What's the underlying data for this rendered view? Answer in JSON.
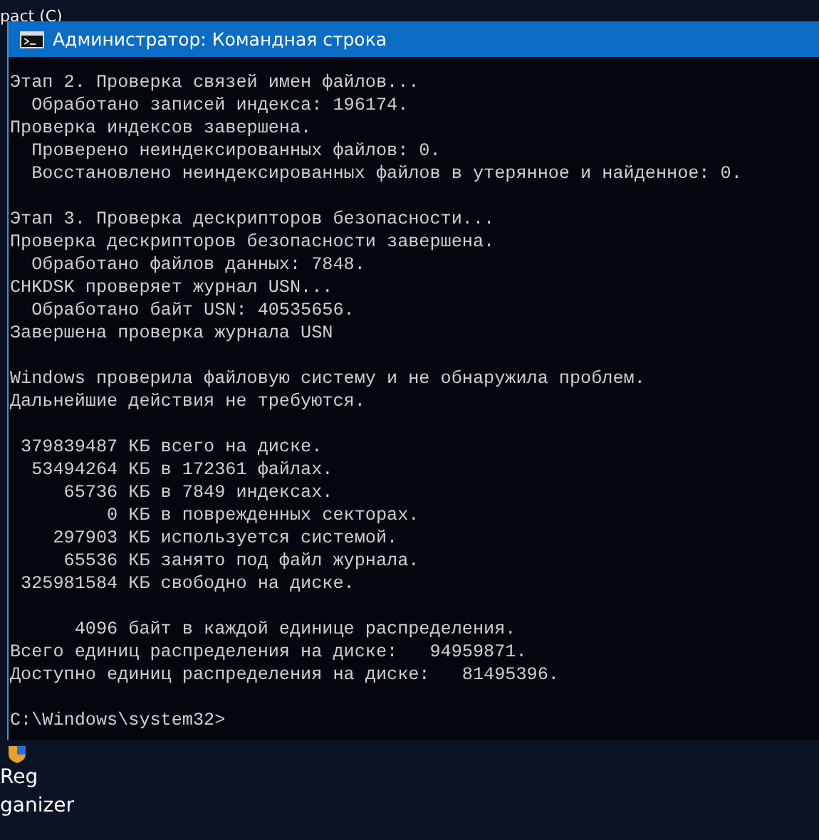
{
  "desktop_top": {
    "label": "pact (C)"
  },
  "window": {
    "title": "Администратор: Командная строка",
    "blocks": [
      [
        "Этап 2. Проверка связей имен файлов...",
        "  Обработано записей индекса: 196174.",
        "Проверка индексов завершена.",
        "  Проверено неиндексированных файлов: 0.",
        "  Восстановлено неиндексированных файлов в утерянное и найденное: 0."
      ],
      [
        "Этап 3. Проверка дескрипторов безопасности...",
        "Проверка дескрипторов безопасности завершена.",
        "  Обработано файлов данных: 7848.",
        "CHKDSK проверяет журнал USN...",
        "  Обработано байт USN: 40535656.",
        "Завершена проверка журнала USN"
      ],
      [
        "Windows проверила файловую систему и не обнаружила проблем.",
        "Дальнейшие действия не требуются."
      ],
      [
        " 379839487 КБ всего на диске.",
        "  53494264 КБ в 172361 файлах.",
        "     65736 КБ в 7849 индексах.",
        "         0 КБ в поврежденных секторах.",
        "    297903 КБ используется системой.",
        "     65536 КБ занято под файл журнала.",
        " 325981584 КБ свободно на диске."
      ],
      [
        "      4096 байт в каждой единице распределения.",
        "Всего единиц распределения на диске:   94959871.",
        "Доступно единиц распределения на диске:   81495396."
      ],
      [
        "C:\\Windows\\system32>"
      ]
    ]
  },
  "desktop_bottom": {
    "label_lines": [
      "Reg",
      "ganizer"
    ]
  }
}
